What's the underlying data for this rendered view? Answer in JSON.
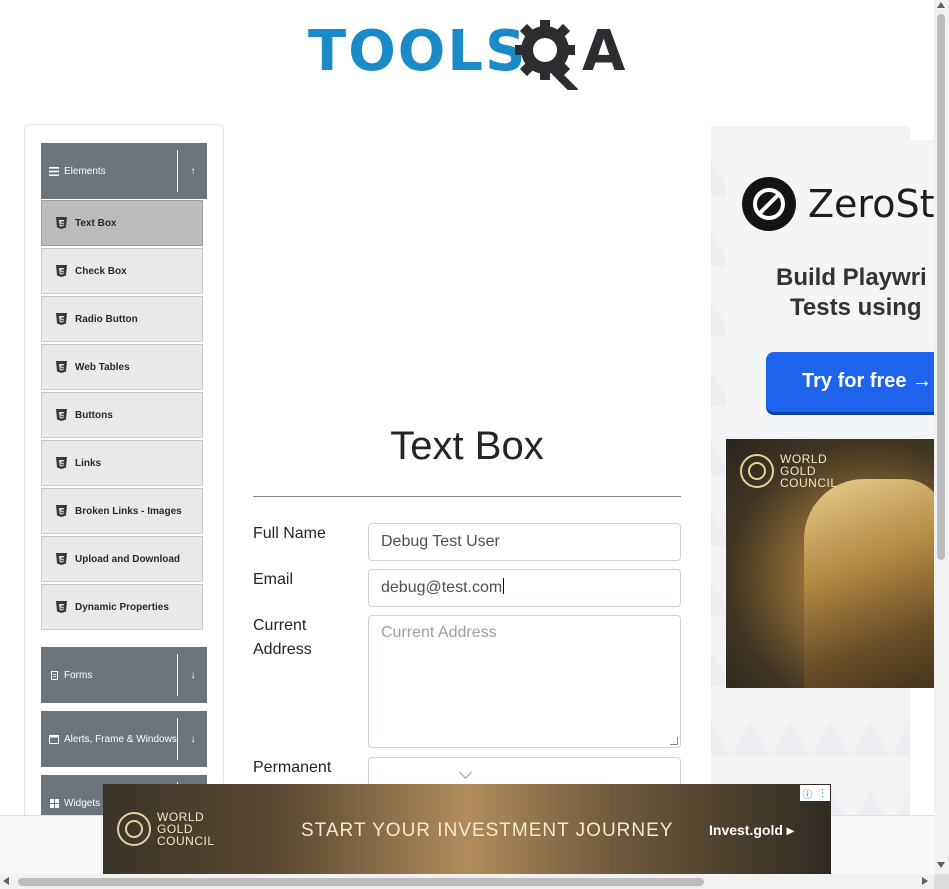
{
  "header": {
    "logo_text": "TOOLS",
    "logo_a": "A"
  },
  "sidebar": {
    "groups": [
      {
        "label": "Elements",
        "icon": "hamburger-icon",
        "arrow": "↑"
      },
      {
        "label": "Forms",
        "icon": "doc-icon",
        "arrow": "↓"
      },
      {
        "label": "Alerts, Frame & Windows",
        "icon": "window-icon",
        "arrow": "↓"
      },
      {
        "label": "Widgets",
        "icon": "grid-icon",
        "arrow": "↓"
      }
    ],
    "items": [
      {
        "label": "Text Box",
        "active": true
      },
      {
        "label": "Check Box"
      },
      {
        "label": "Radio Button"
      },
      {
        "label": "Web Tables"
      },
      {
        "label": "Buttons"
      },
      {
        "label": "Links"
      },
      {
        "label": "Broken Links - Images"
      },
      {
        "label": "Upload and Download"
      },
      {
        "label": "Dynamic Properties"
      }
    ]
  },
  "main": {
    "title": "Text Box",
    "full_name": {
      "label": "Full Name",
      "value": "Debug Test User"
    },
    "email": {
      "label": "Email",
      "value": "debug@test.com"
    },
    "current_address": {
      "label_line1": "Current",
      "label_line2": "Address",
      "placeholder": "Current Address"
    },
    "permanent_address": {
      "label": "Permanent"
    }
  },
  "ads": {
    "zerostep": {
      "brand": "ZeroSt",
      "line1": "Build Playwri",
      "line2": "Tests using",
      "cta": "Try for free →"
    },
    "gold_side": {
      "org_line1": "WORLD",
      "org_line2": "GOLD",
      "org_line3": "COUNCIL"
    },
    "gold_banner": {
      "org_line1": "WORLD",
      "org_line2": "GOLD",
      "org_line3": "COUNCIL",
      "headline": "START YOUR INVESTMENT JOURNEY",
      "cta": "Invest.gold ▸",
      "adchoices_i": "ⓘ",
      "adchoices_x": "⋮"
    }
  },
  "colors": {
    "brand_blue": "#1b8bc7",
    "sidebar_header": "#6c757d",
    "cta_blue": "#1d63ed"
  }
}
